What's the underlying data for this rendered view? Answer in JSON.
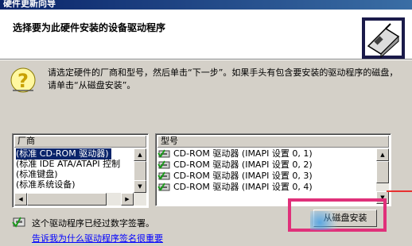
{
  "window": {
    "title": "硬件更新向导"
  },
  "header": {
    "title": "选择要为此硬件安装的设备驱动程序"
  },
  "instructions": "请选定硬件的厂商和型号，然后单击“下一步”。如果手头有包含要安装的驱动程序的磁盘，请单击“从磁盘安装”。",
  "manufacturer": {
    "header": "厂商",
    "items": [
      "(标准 CD-ROM 驱动器)",
      "(标准 IDE ATA/ATAPI 控制",
      "(标准键盘)",
      "(标准系统设备)"
    ]
  },
  "model": {
    "header": "型号",
    "items": [
      "CD-ROM 驱动器 (IMAPI 设置 0, 1)",
      "CD-ROM 驱动器 (IMAPI 设置 0, 2)",
      "CD-ROM 驱动器 (IMAPI 设置 0, 3)",
      "CD-ROM 驱动器 (IMAPI 设置 0, 4)"
    ]
  },
  "signature": {
    "text": "这个驱动程序已经过数字签署。",
    "link": "告诉我为什么驱动程序签名很重要"
  },
  "buttons": {
    "have_disk": "从磁盘安装"
  },
  "colors": {
    "highlight_box": "#e0307a",
    "selection": "#0a246a",
    "link": "#0000ff"
  }
}
